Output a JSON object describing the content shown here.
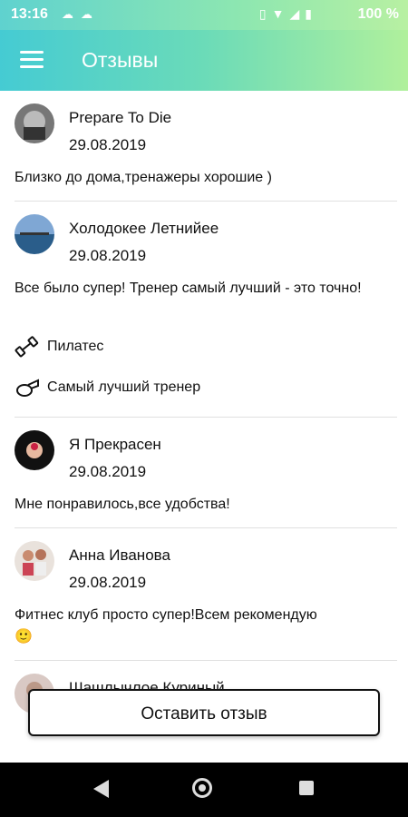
{
  "status_bar": {
    "time": "13:16",
    "battery": "100 %",
    "icons": [
      "weather-icon",
      "weather-icon",
      "vibrate-icon",
      "wifi-icon",
      "signal-icon",
      "battery-icon"
    ]
  },
  "app_bar": {
    "title": "Отзывы",
    "menu_icon": "hamburger-icon"
  },
  "reviews": [
    {
      "name": "Prepare To Die",
      "date": "29.08.2019",
      "text": "Близко до дома,тренажеры хорошие )"
    },
    {
      "name": "Холодокее Летнийее",
      "date": "29.08.2019",
      "text": "Все было супер! Тренер самый лучший - это точно!",
      "tags": [
        {
          "icon": "dumbbell-icon",
          "label": "Пилатес"
        },
        {
          "icon": "whistle-icon",
          "label": "Самый лучший тренер"
        }
      ]
    },
    {
      "name": "Я Прекрасен",
      "date": "29.08.2019",
      "text": "Мне понравилось,все удобства!"
    },
    {
      "name": "Анна Иванова",
      "date": "29.08.2019",
      "text": "Фитнес клуб просто супер!Всем рекомендую",
      "emoji": "🙂"
    },
    {
      "name": "Шашлычлое Куриный",
      "date": ""
    }
  ],
  "leave_review_button": "Оставить отзыв",
  "colors": {
    "gradient_start": "#45cbd3",
    "gradient_end": "#b0f09c"
  }
}
